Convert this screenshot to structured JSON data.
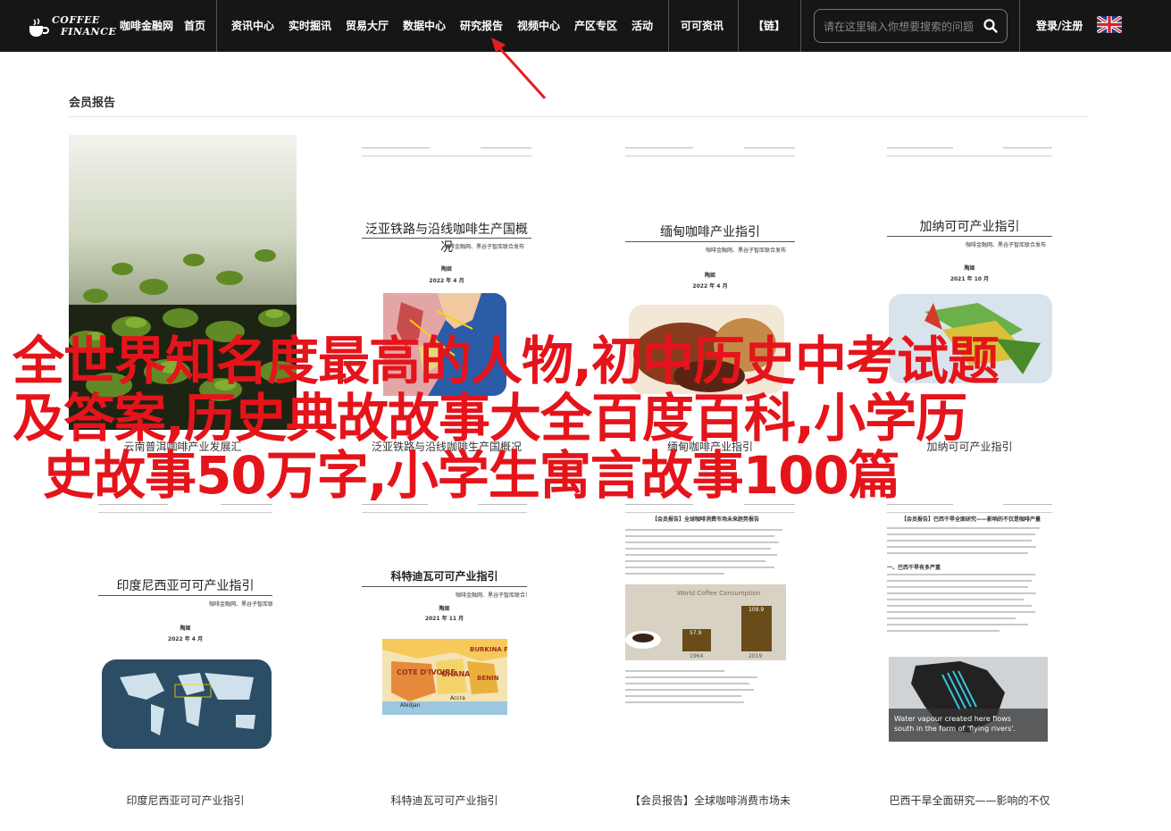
{
  "logo": {
    "line1": "COFFEE",
    "line2": "FINANCE"
  },
  "nav": {
    "items": [
      "咖啡金融网",
      "首页",
      "资讯中心",
      "实时掘讯",
      "贸易大厅",
      "数据中心",
      "研究报告",
      "视频中心",
      "产区专区",
      "活动",
      "可可资讯",
      "【链】"
    ],
    "login": "登录/注册"
  },
  "search": {
    "placeholder": "请在这里输入你想要搜索的问题"
  },
  "section": {
    "title": "会员报告"
  },
  "overlay": {
    "line1": "全世界知名度最高的人物,初中历史中考试题",
    "line2": "及答案,历史典故故事大全百度百科,小学历",
    "line3": "史故事50万字,小学生寓言故事100篇"
  },
  "row1": [
    {
      "caption": "云南普洱咖啡产业发展汇"
    },
    {
      "doc_title": "泛亚铁路与沿线咖啡生产国概况",
      "doc_sub": "咖啡金融网、黑谷子智库联合发布",
      "doc_author": "陶姬",
      "doc_date": "2022 年 4 月",
      "caption": "泛亚铁路与沿线咖啡生产国概况"
    },
    {
      "doc_title": "缅甸咖啡产业指引",
      "doc_sub": "咖啡金融网、黑谷子智库联合发布",
      "doc_author": "陶姬",
      "doc_date": "2022 年 4 月",
      "caption": "缅甸咖啡产业指引"
    },
    {
      "doc_title": "加纳可可产业指引",
      "doc_sub": "咖啡金融网、黑谷子智库联合发布",
      "doc_author": "陶姬",
      "doc_date": "2021 年 10 月",
      "caption": "加纳可可产业指引"
    }
  ],
  "row2": [
    {
      "doc_title": "印度尼西亚可可产业指引",
      "doc_sub": "咖啡金融网、黑谷子智库联合发布",
      "doc_author": "陶姬",
      "doc_date": "2022 年 4 月",
      "caption": "印度尼西亚可可产业指引"
    },
    {
      "doc_title": "科特迪瓦可可产业指引",
      "doc_sub": "咖啡金融网、黑谷子智库联合发布",
      "doc_author": "陶姬",
      "doc_date": "2021 年 11 月",
      "map_labels": [
        "BURKINA FASO",
        "COTE D'IVOIRE",
        "GHANA",
        "BENIN",
        "Abidjan",
        "Accra"
      ],
      "caption": "科特迪瓦可可产业指引"
    },
    {
      "doc_title": "【会员报告】全球咖啡消费市场未来趋势报告",
      "chart_title": "World Coffee Consumption",
      "chart_values": [
        "57.9",
        "109.9"
      ],
      "chart_years": [
        "1964",
        "2019"
      ],
      "caption": "【会员报告】全球咖啡消费市场未"
    },
    {
      "doc_title": "【会员报告】巴西干旱全面研究——影响的不仅是咖啡产量",
      "doc_heading": "一、巴西干旱有多严重",
      "photo_text_1": "Water vapour created here flows",
      "photo_text_2": "south in the form of 'flying rivers'.",
      "caption": "巴西干旱全面研究——影响的不仅"
    }
  ]
}
